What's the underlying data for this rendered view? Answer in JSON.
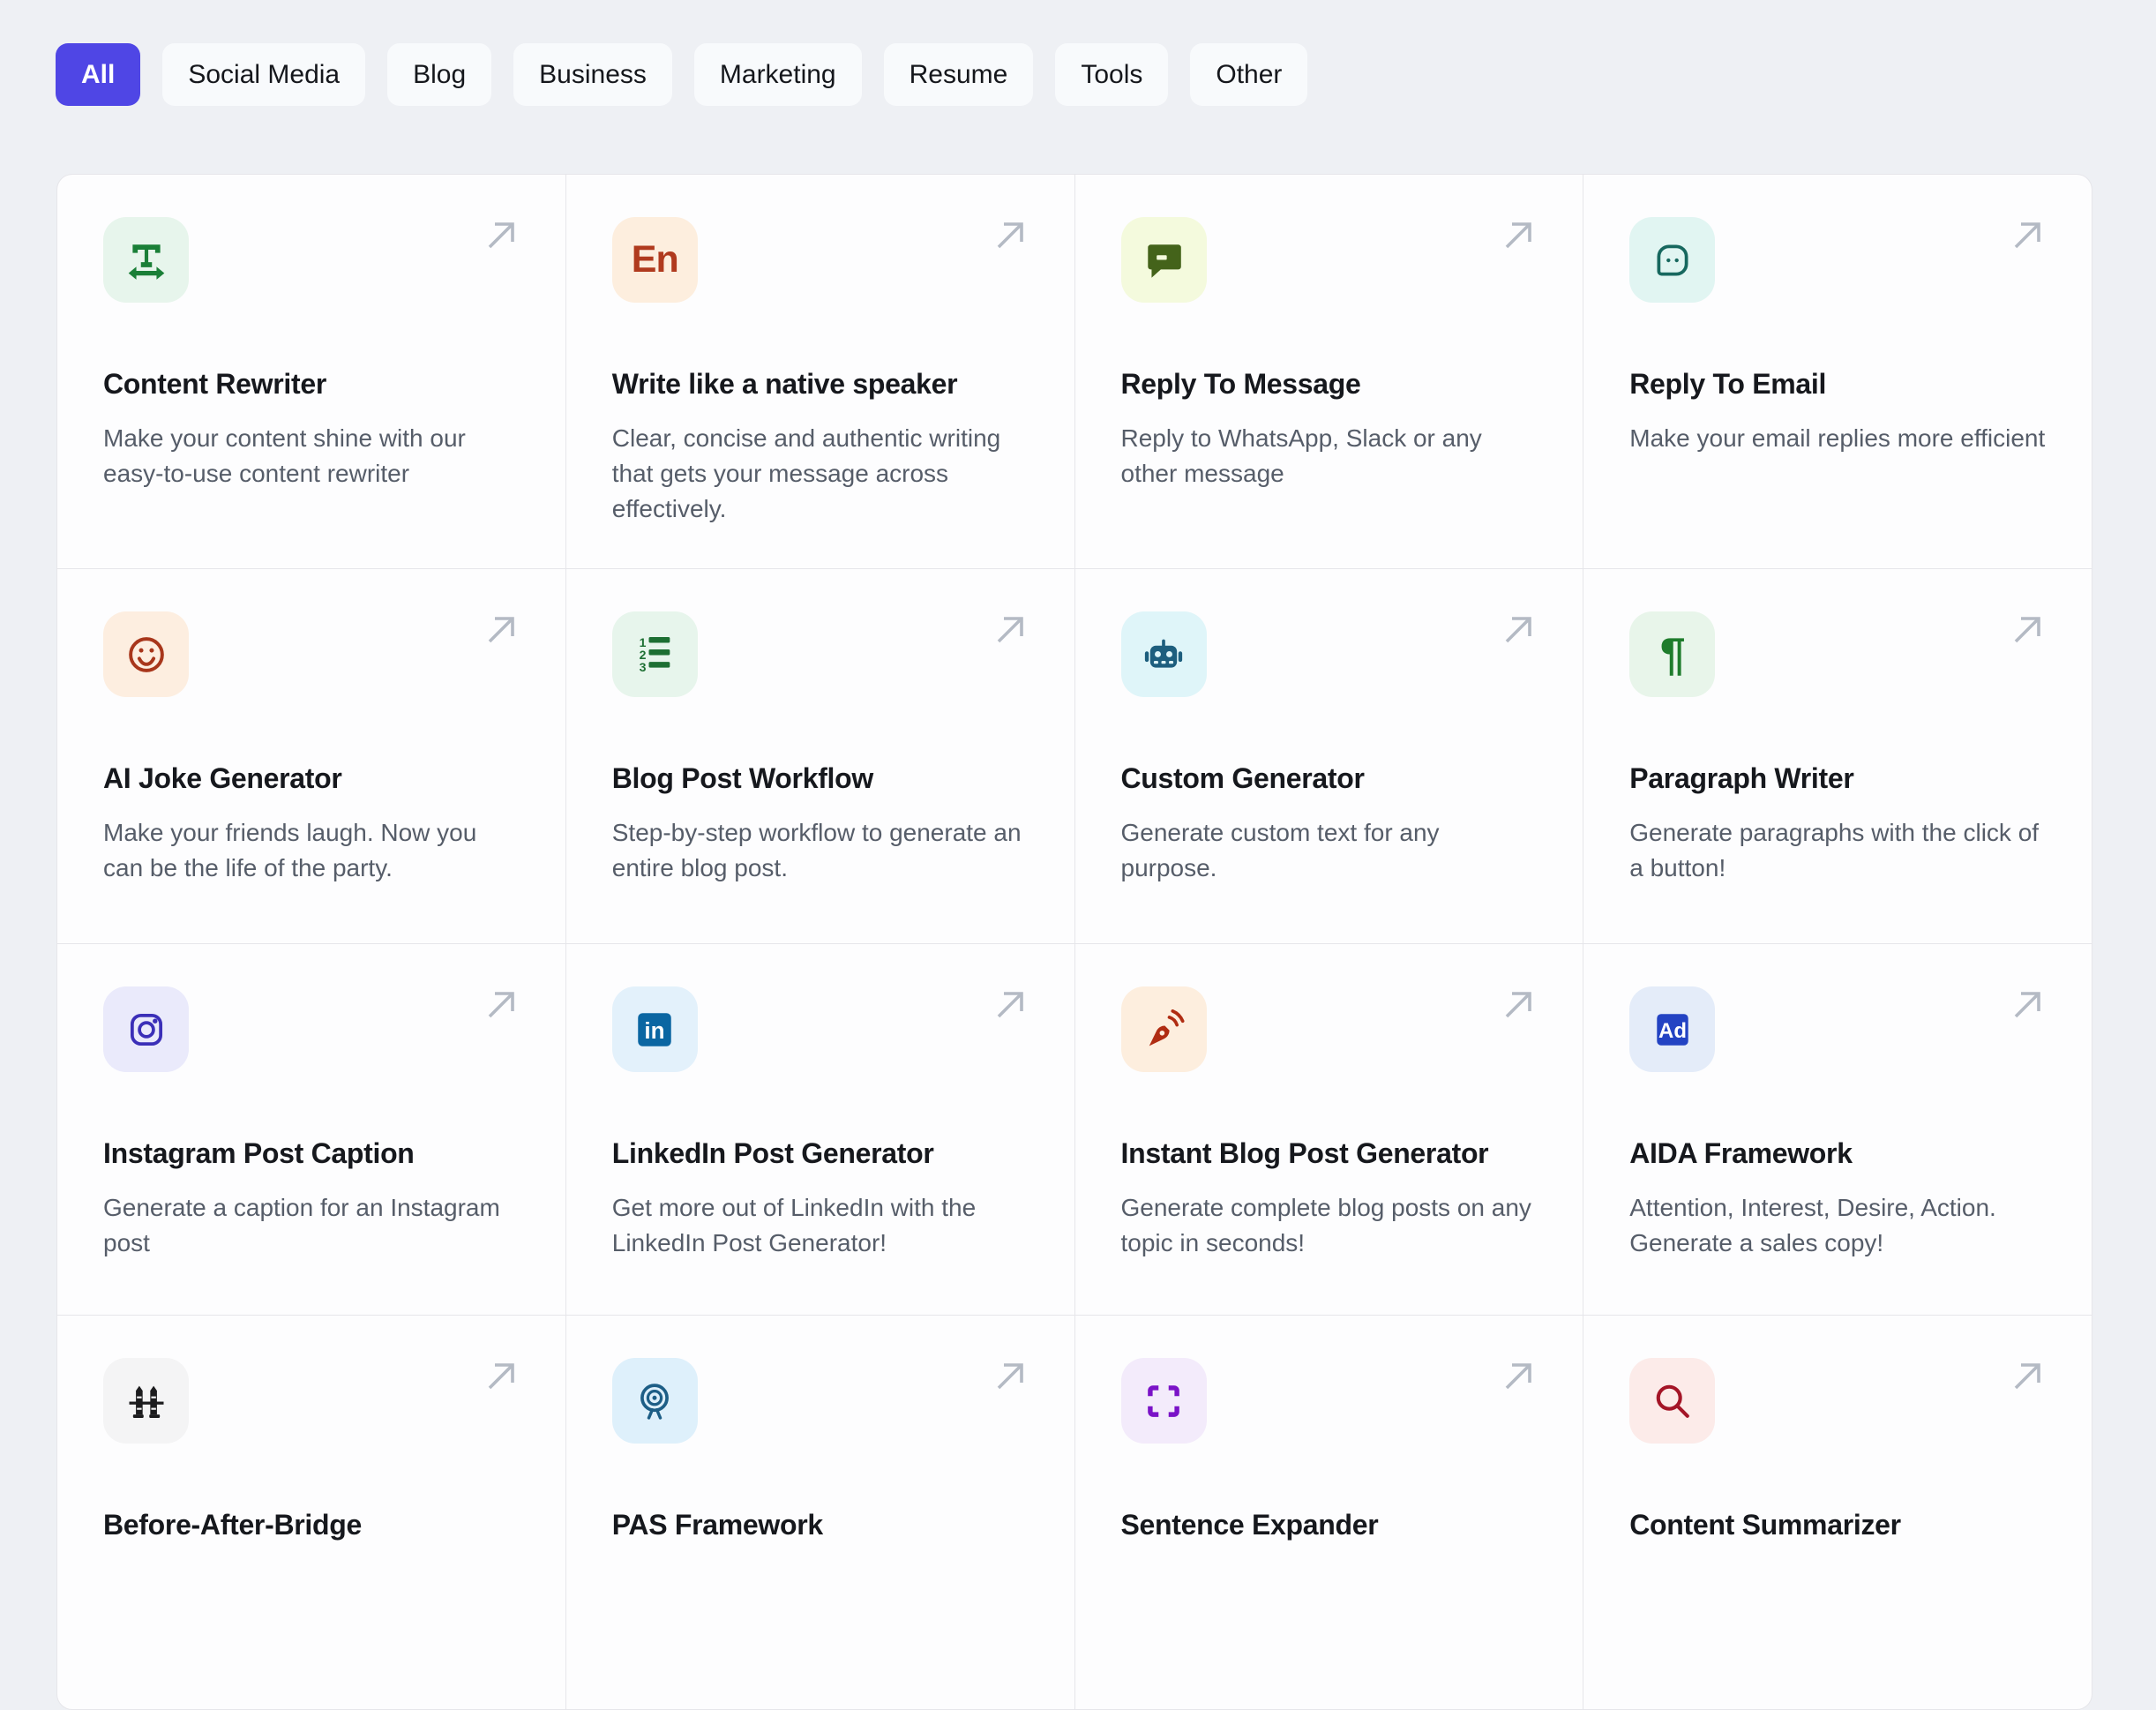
{
  "tabs": [
    {
      "label": "All",
      "active": true
    },
    {
      "label": "Social Media",
      "active": false
    },
    {
      "label": "Blog",
      "active": false
    },
    {
      "label": "Business",
      "active": false
    },
    {
      "label": "Marketing",
      "active": false
    },
    {
      "label": "Resume",
      "active": false
    },
    {
      "label": "Tools",
      "active": false
    },
    {
      "label": "Other",
      "active": false
    }
  ],
  "colors": {
    "page_background": "#eef0f4",
    "active_tab": "#4f46e5",
    "card_background": "#fdfdfe",
    "grid_border": "#e6e6ea",
    "title_text": "#16181d",
    "description_text": "#565d69",
    "arrow_icon": "#b4bac4"
  },
  "cards": [
    {
      "title": "Content Rewriter",
      "description": "Make your content shine with our easy-to-use content rewriter",
      "icon": "text-width",
      "icon_bg": "#e7f5ec",
      "icon_color": "#1a7f37"
    },
    {
      "title": "Write like a native speaker",
      "description": "Clear, concise and authentic writing that gets your message across effectively.",
      "icon": "en-letters",
      "icon_bg": "#fdeede",
      "icon_color": "#b03a1e"
    },
    {
      "title": "Reply To Message",
      "description": "Reply to WhatsApp, Slack or any other message",
      "icon": "message-bubble",
      "icon_bg": "#f4fadd",
      "icon_color": "#44631a"
    },
    {
      "title": "Reply To Email",
      "description": "Make your email replies more efficient",
      "icon": "chat-dots",
      "icon_bg": "#e1f5f2",
      "icon_color": "#17685f"
    },
    {
      "title": "AI Joke Generator",
      "description": "Make your friends laugh. Now you can be the life of the party.",
      "icon": "smiley",
      "icon_bg": "#fdeee0",
      "icon_color": "#a8361b"
    },
    {
      "title": "Blog Post Workflow",
      "description": "Step-by-step workflow to generate an entire blog post.",
      "icon": "numbered-list",
      "icon_bg": "#e7f5ec",
      "icon_color": "#1d6f33"
    },
    {
      "title": "Custom Generator",
      "description": "Generate custom text for any purpose.",
      "icon": "robot",
      "icon_bg": "#dff5f9",
      "icon_color": "#1d5e7e"
    },
    {
      "title": "Paragraph Writer",
      "description": "Generate paragraphs with the click of a button!",
      "icon": "pilcrow",
      "icon_bg": "#e8f5ea",
      "icon_color": "#1e7c2c"
    },
    {
      "title": "Instagram Post Caption",
      "description": "Generate a caption for an Instagram post",
      "icon": "instagram",
      "icon_bg": "#eaeafb",
      "icon_color": "#3b2fb8"
    },
    {
      "title": "LinkedIn Post Generator",
      "description": "Get more out of LinkedIn with the LinkedIn Post Generator!",
      "icon": "linkedin",
      "icon_bg": "#e3f1fb",
      "icon_color": "#0b66a2"
    },
    {
      "title": "Instant Blog Post Generator",
      "description": "Generate complete blog posts on any topic in seconds!",
      "icon": "pen-signal",
      "icon_bg": "#fdeede",
      "icon_color": "#b02c12"
    },
    {
      "title": "AIDA Framework",
      "description": "Attention, Interest, Desire, Action. Generate a sales copy!",
      "icon": "ad-badge",
      "icon_bg": "#e4ecf9",
      "icon_color": "#2343c3"
    },
    {
      "title": "Before-After-Bridge",
      "description": "",
      "icon": "bridge",
      "icon_bg": "#f4f4f5",
      "icon_color": "#1c1c1e"
    },
    {
      "title": "PAS Framework",
      "description": "",
      "icon": "target",
      "icon_bg": "#def0fb",
      "icon_color": "#1d5e86"
    },
    {
      "title": "Sentence Expander",
      "description": "",
      "icon": "expand",
      "icon_bg": "#f3ebfb",
      "icon_color": "#7a12c7"
    },
    {
      "title": "Content Summarizer",
      "description": "",
      "icon": "magnifier",
      "icon_bg": "#fcebe9",
      "icon_color": "#a41527"
    }
  ]
}
